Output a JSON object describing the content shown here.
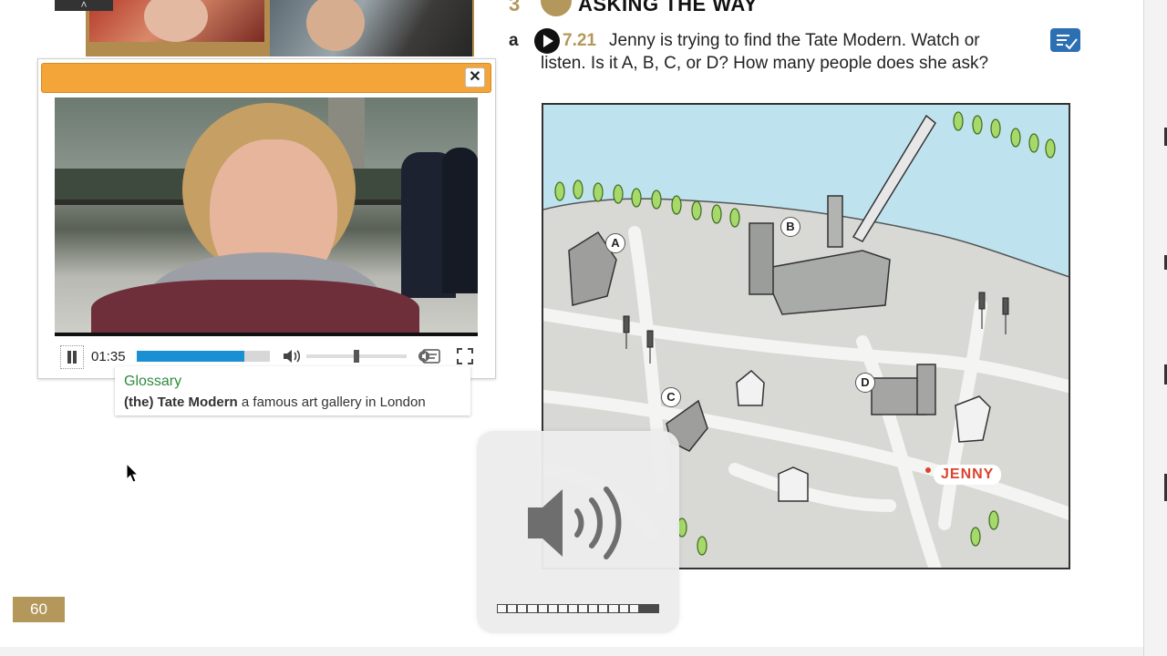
{
  "book": {
    "section_number": "3",
    "section_title": "ASKING THE WAY",
    "page_number": "60"
  },
  "exercise": {
    "letter": "a",
    "track": "7.21",
    "prompt_line1": "Jenny is trying to find the Tate Modern. Watch or",
    "prompt_line2": "listen. Is it A, B, C, or D? How many people does she ask?"
  },
  "video_player": {
    "current_time": "01:35",
    "progress": 0.81,
    "volume": 0.5,
    "close_symbol": "✕"
  },
  "glossary": {
    "title": "Glossary",
    "term": "(the) Tate Modern",
    "definition": "a famous art gallery in London"
  },
  "map": {
    "labels": [
      "A",
      "B",
      "C",
      "D"
    ],
    "person_label": "JENNY"
  },
  "volume_hud": {
    "level_segments": 16,
    "total_segments": 16
  },
  "colors": {
    "accent_gold": "#b4975a",
    "player_bar": "#f3a53a",
    "progress_blue": "#1a8fd1",
    "glossary_green": "#2f8a3e",
    "river": "#bfe3ee",
    "jenny_red": "#d9432f"
  },
  "icons": [
    "close-icon",
    "pause-icon",
    "volume-icon",
    "captions-icon",
    "fullscreen-icon",
    "play-icon",
    "notes-icon",
    "speaker-icon",
    "cursor-icon"
  ]
}
